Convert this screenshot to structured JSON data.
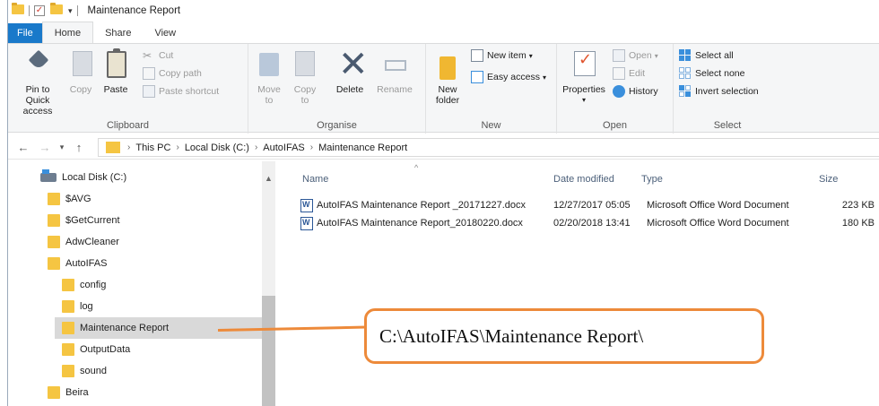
{
  "window": {
    "title": "Maintenance Report"
  },
  "tabs": [
    {
      "label": "File"
    },
    {
      "label": "Home"
    },
    {
      "label": "Share"
    },
    {
      "label": "View"
    }
  ],
  "ribbon": {
    "clipboard": {
      "group_label": "Clipboard",
      "pin_label": "Pin to Quick access",
      "copy_label": "Copy",
      "paste_label": "Paste",
      "cut_label": "Cut",
      "copy_path_label": "Copy path",
      "paste_shortcut_label": "Paste shortcut"
    },
    "organise": {
      "group_label": "Organise",
      "move_label": "Move to",
      "copy_to_label": "Copy to",
      "delete_label": "Delete",
      "rename_label": "Rename"
    },
    "new": {
      "group_label": "New",
      "new_folder_label": "New folder",
      "new_item_label": "New item",
      "easy_access_label": "Easy access"
    },
    "open": {
      "group_label": "Open",
      "properties_label": "Properties",
      "open_label": "Open",
      "edit_label": "Edit",
      "history_label": "History"
    },
    "select": {
      "group_label": "Select",
      "select_all_label": "Select all",
      "select_none_label": "Select none",
      "invert_label": "Invert selection"
    }
  },
  "address": {
    "crumbs": [
      "This PC",
      "Local Disk (C:)",
      "AutoIFAS",
      "Maintenance Report"
    ]
  },
  "nav_tree": [
    {
      "label": "Local Disk (C:)",
      "type": "drive"
    },
    {
      "label": "$AVG",
      "type": "folder"
    },
    {
      "label": "$GetCurrent",
      "type": "folder"
    },
    {
      "label": "AdwCleaner",
      "type": "folder"
    },
    {
      "label": "AutoIFAS",
      "type": "folder"
    },
    {
      "label": "config",
      "type": "folder"
    },
    {
      "label": "log",
      "type": "folder"
    },
    {
      "label": "Maintenance Report",
      "type": "folder",
      "selected": true
    },
    {
      "label": "OutputData",
      "type": "folder"
    },
    {
      "label": "sound",
      "type": "folder"
    },
    {
      "label": "Beira",
      "type": "folder"
    }
  ],
  "file_list": {
    "columns": {
      "name": "Name",
      "date": "Date modified",
      "type": "Type",
      "size": "Size"
    },
    "rows": [
      {
        "name": "AutoIFAS Maintenance Report _20171227.docx",
        "date": "12/27/2017 05:05",
        "type": "Microsoft Office Word Document",
        "size": "223 KB"
      },
      {
        "name": "AutoIFAS Maintenance Report_20180220.docx",
        "date": "02/20/2018 13:41",
        "type": "Microsoft Office Word Document",
        "size": "180 KB"
      }
    ]
  },
  "callout": {
    "text": "C:\\AutoIFAS\\Maintenance Report\\"
  },
  "colors": {
    "file_tab": "#1979ca",
    "callout_border": "#ed8a3a",
    "selection": "#d9d9d9",
    "folder": "#f5c542"
  }
}
